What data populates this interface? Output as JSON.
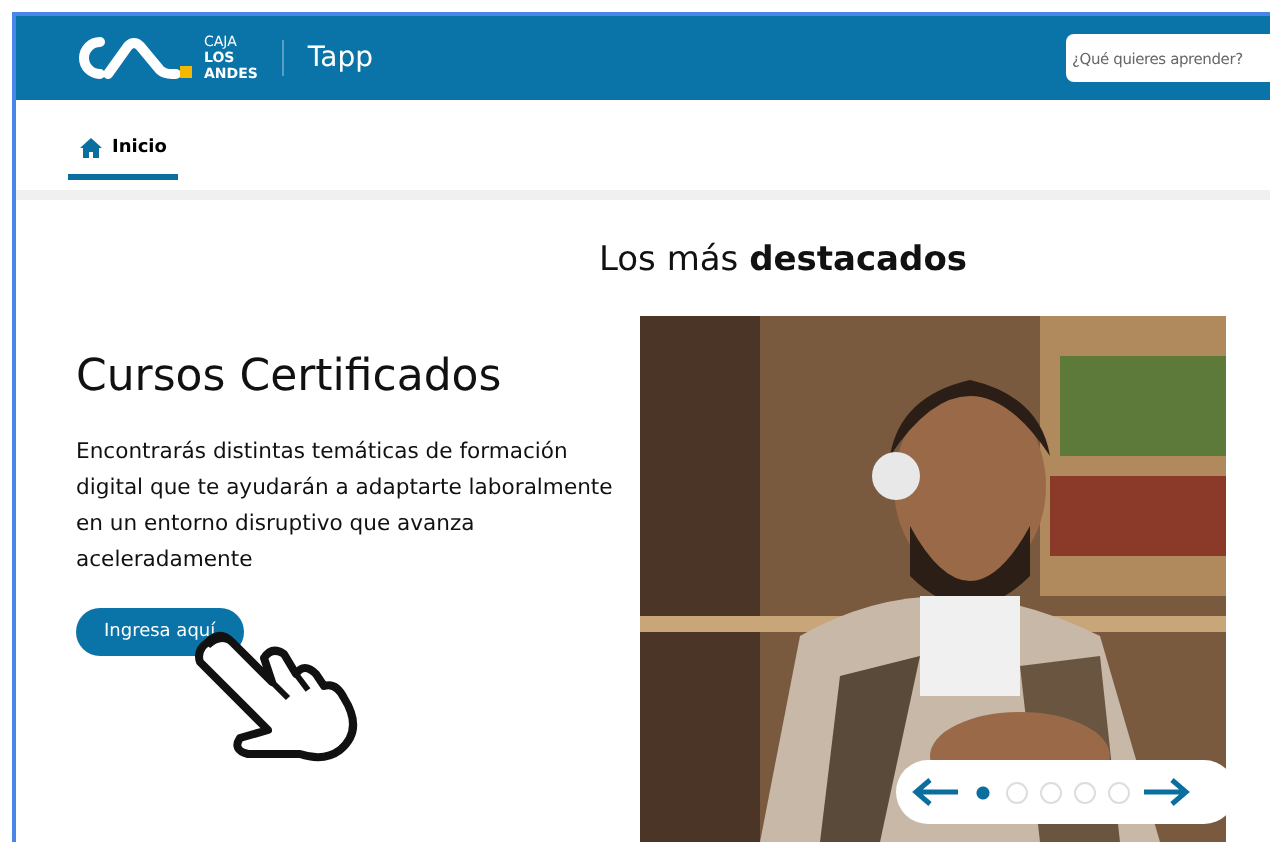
{
  "header": {
    "brand_top": "CAJA",
    "brand_mid": "LOS",
    "brand_bottom": "ANDES",
    "app_name": "Tapp",
    "search": {
      "placeholder": "¿Qué quieres aprender?"
    }
  },
  "nav": {
    "items": [
      {
        "label": "Inicio",
        "selected": true
      }
    ]
  },
  "section_title": "Los más **destacados**",
  "feature": {
    "title": "Cursos Certificados",
    "description": "Encontrarás distintas temáticas de formación digital que te ayudarán a adaptarte laboralmente en un entorno disruptivo que avanza aceleradamente",
    "button": "Ingresa aquí"
  },
  "carousel": {
    "dots": [
      {
        "selected": true
      },
      {
        "selected": false
      },
      {
        "selected": false
      },
      {
        "selected": false
      },
      {
        "selected": false
      }
    ]
  }
}
